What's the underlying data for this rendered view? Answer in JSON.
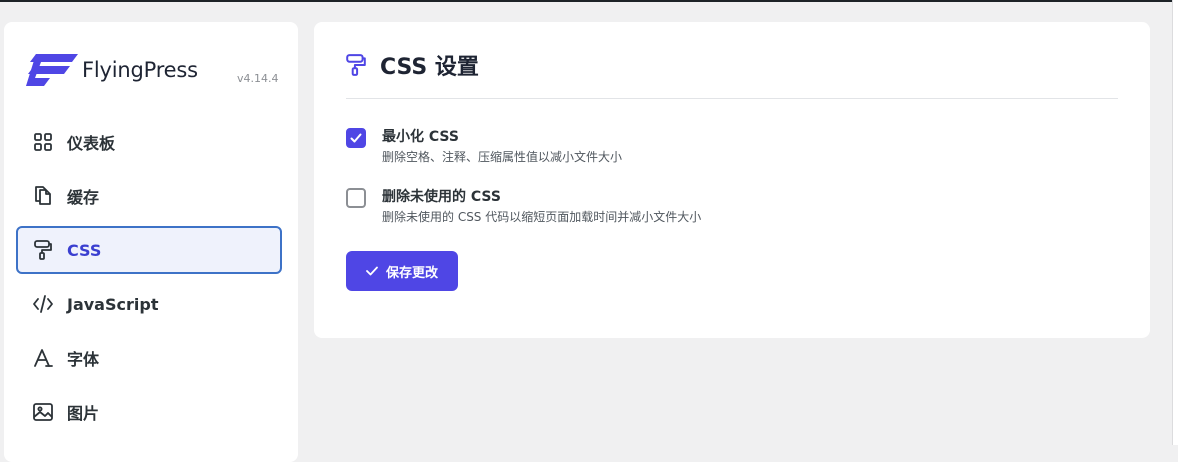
{
  "brand": {
    "name": "FlyingPress",
    "version": "v4.14.4",
    "logo_color": "#4f46e5"
  },
  "nav": {
    "items": [
      {
        "label": "仪表板",
        "icon": "dashboard-grid-icon"
      },
      {
        "label": "缓存",
        "icon": "files-copy-icon"
      },
      {
        "label": "CSS",
        "icon": "paint-roller-icon",
        "active": true
      },
      {
        "label": "JavaScript",
        "icon": "code-icon"
      },
      {
        "label": "字体",
        "icon": "font-letter-icon"
      },
      {
        "label": "图片",
        "icon": "image-icon"
      }
    ]
  },
  "panel": {
    "title": "CSS 设置",
    "icon": "paint-roller-icon",
    "options": [
      {
        "label": "最小化 CSS",
        "description": "删除空格、注释、压缩属性值以减小文件大小",
        "checked": true
      },
      {
        "label": "删除未使用的 CSS",
        "description": "删除未使用的 CSS 代码以缩短页面加载时间并减小文件大小",
        "checked": false
      }
    ],
    "save_label": "保存更改"
  },
  "colors": {
    "accent": "#4f46e5",
    "active_border": "#3d72c7",
    "active_bg": "#eff2fc"
  }
}
